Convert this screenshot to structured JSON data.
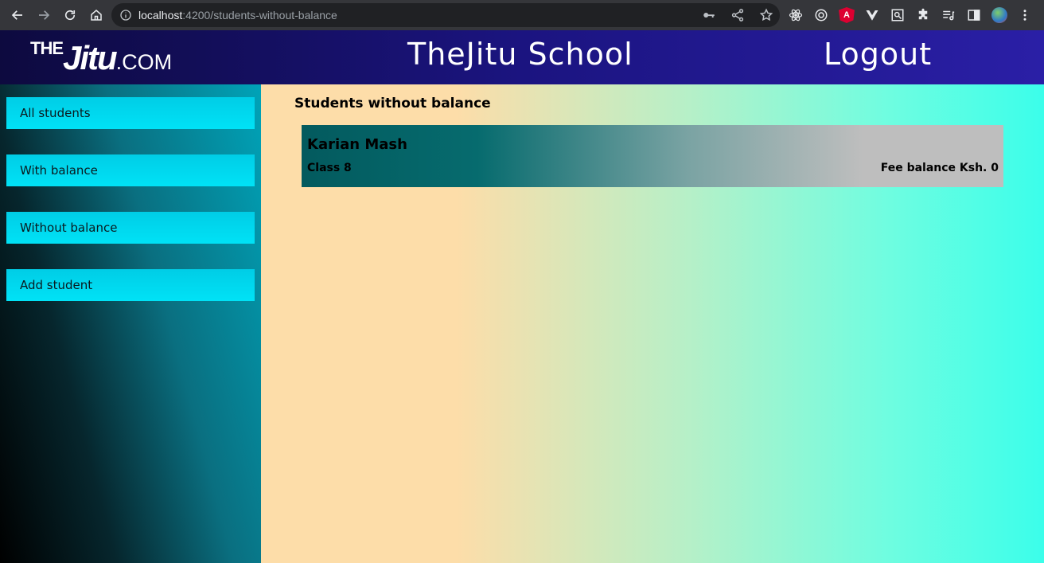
{
  "browser": {
    "url_host": "localhost",
    "url_path": ":4200/students-without-balance"
  },
  "header": {
    "logo": {
      "the": "THE",
      "jitu": "Jitu",
      "com": ".COM"
    },
    "title": "TheJitu School",
    "logout_label": "Logout"
  },
  "sidebar": {
    "items": [
      {
        "label": "All students"
      },
      {
        "label": "With balance"
      },
      {
        "label": "Without balance"
      },
      {
        "label": "Add student"
      }
    ]
  },
  "main": {
    "title": "Students without balance",
    "students": [
      {
        "name": "Karian Mash",
        "class": "Class 8",
        "fee": "Fee balance Ksh. 0"
      }
    ]
  }
}
